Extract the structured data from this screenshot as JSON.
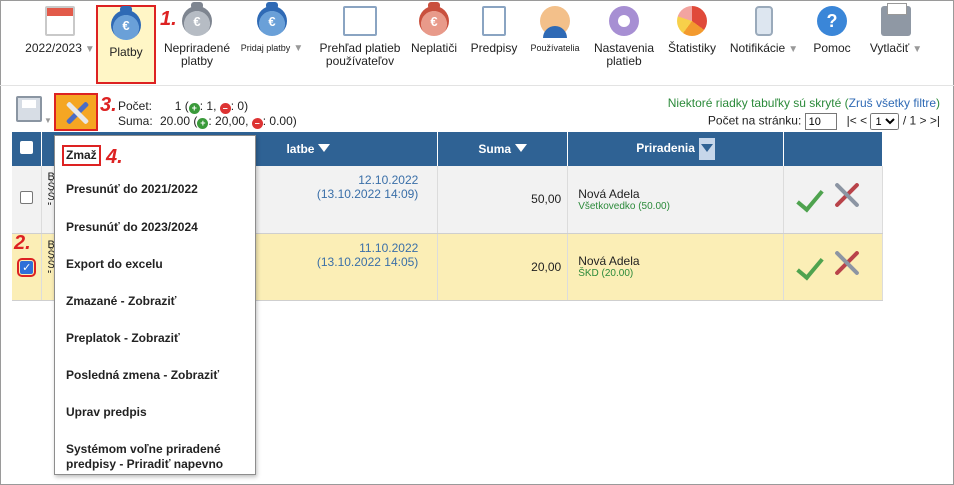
{
  "toolbar": {
    "items": [
      {
        "label": "2022/2023",
        "icon": "calendar-icon",
        "caret": "▼"
      },
      {
        "label": "Platby",
        "icon": "money-bag-euro-icon"
      },
      {
        "label": "Nepriradené platby",
        "icon": "money-bag-grey-icon"
      },
      {
        "label": "Pridaj platby",
        "icon": "money-bag-add-icon",
        "caret": "▼"
      },
      {
        "label": "Prehľad platieb používateľov",
        "icon": "ledger-euro-icon"
      },
      {
        "label": "Neplatiči",
        "icon": "money-bag-red-icon"
      },
      {
        "label": "Predpisy",
        "icon": "document-icon"
      },
      {
        "label": "Používatelia",
        "icon": "user-icon"
      },
      {
        "label": "Nastavenia platieb",
        "icon": "gear-icon"
      },
      {
        "label": "Štatistiky",
        "icon": "pie-chart-icon"
      },
      {
        "label": "Notifikácie",
        "icon": "phone-icon",
        "caret": "▼"
      },
      {
        "label": "Pomoc",
        "icon": "help-icon"
      },
      {
        "label": "Vytlačiť",
        "icon": "printer-icon",
        "caret": "▼"
      }
    ]
  },
  "steps": [
    "1.",
    "2.",
    "3.",
    "4."
  ],
  "summary": {
    "count_label": "Počet:",
    "count_value": "1",
    "count_plus": "1",
    "count_minus": "0",
    "sum_label": "Suma:",
    "sum_value": "20.00",
    "sum_plus": "20,00",
    "sum_minus": "0.00"
  },
  "notice": {
    "text": "Niektoré riadky tabuľky sú skryté",
    "link": "Zruš všetky filtre"
  },
  "paging": {
    "label": "Počet na stránku:",
    "per_page": "10",
    "first": "|<",
    "prev": "<",
    "page": "1",
    "of": "/ 1",
    "next": ">",
    "last": ">|"
  },
  "table": {
    "headers": {
      "date": "latbe",
      "sum": "Suma",
      "assignments": "Priradenia"
    },
    "rows": [
      {
        "checked": false,
        "desc_lines": [
          "B",
          "Š",
          "Š",
          "\""
        ],
        "date": "12.10.2022",
        "datetime": "(13.10.2022 14:09)",
        "sum": "50,00",
        "name": "Nová Adela",
        "item": "Všetkovedko (50.00)"
      },
      {
        "checked": true,
        "desc_lines": [
          "B",
          "Š",
          "Š",
          "\""
        ],
        "date": "11.10.2022",
        "datetime": "(13.10.2022 14:05)",
        "sum": "20,00",
        "name": "Nová Adela",
        "item": "ŠKD (20.00)"
      }
    ]
  },
  "menu": {
    "items": [
      "Zmaž",
      "Presunúť do 2021/2022",
      "Presunúť do 2023/2024",
      "Export do excelu",
      "Zmazané - Zobraziť",
      "Preplatok - Zobraziť",
      "Posledná zmena - Zobraziť",
      "Uprav predpis",
      "Systémom voľne priradené predpisy - Priradiť napevno"
    ],
    "last_line1": "Systémom voľne priradené",
    "last_line2": "predpisy - Priradiť napevno"
  },
  "colors": {
    "header": "#2f6294",
    "selected_row": "#fbeeb6",
    "highlight": "#dd2222",
    "accent_orange": "#f5a623"
  }
}
